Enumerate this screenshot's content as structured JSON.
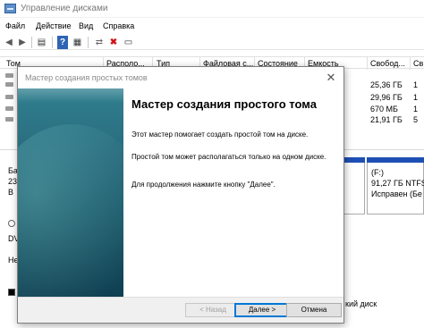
{
  "window": {
    "title": "Управление дисками"
  },
  "menu": [
    "Файл",
    "Действие",
    "Вид",
    "Справка"
  ],
  "toolbar": {
    "back": "◀",
    "forward": "▶",
    "list": "▤",
    "help": "?",
    "props": "▦",
    "delete": "✖",
    "refresh": "▭"
  },
  "volumes": {
    "columns": [
      "Том",
      "Располо...",
      "Тип",
      "Файловая с...",
      "Состояние",
      "Емкость",
      "Свобод...",
      "Св"
    ],
    "rows": [
      {
        "free": "",
        "pct": ""
      },
      {
        "free": "25,36 ГБ",
        "pct": "1"
      },
      {
        "free": "29,96 ГБ",
        "pct": "1"
      },
      {
        "free": "670 МБ",
        "pct": "1"
      },
      {
        "free": "21,91 ГБ",
        "pct": "5"
      }
    ]
  },
  "disk_panel": {
    "disk0_prefix": "Ба",
    "disk0_size": "23",
    "disk0_state": "В",
    "part_title": "(F:)",
    "part_size": "91,27 ГБ NTFS",
    "part_state": "Исправен (Бе",
    "dvd_label": "DV",
    "dvd_state": "Не",
    "legend_tail": "кий диск"
  },
  "wizard": {
    "window_title": "Мастер создания простых томов",
    "close": "✕",
    "heading": "Мастер создания простого тома",
    "para1": "Этот мастер помогает создать простой том на диске.",
    "para2": "Простой том может располагаться только на одном диске.",
    "para3": "Для продолжения нажмите кнопку \"Далее\".",
    "back_button": "< Назад",
    "next_button": "Далее >",
    "cancel_button": "Отмена"
  }
}
